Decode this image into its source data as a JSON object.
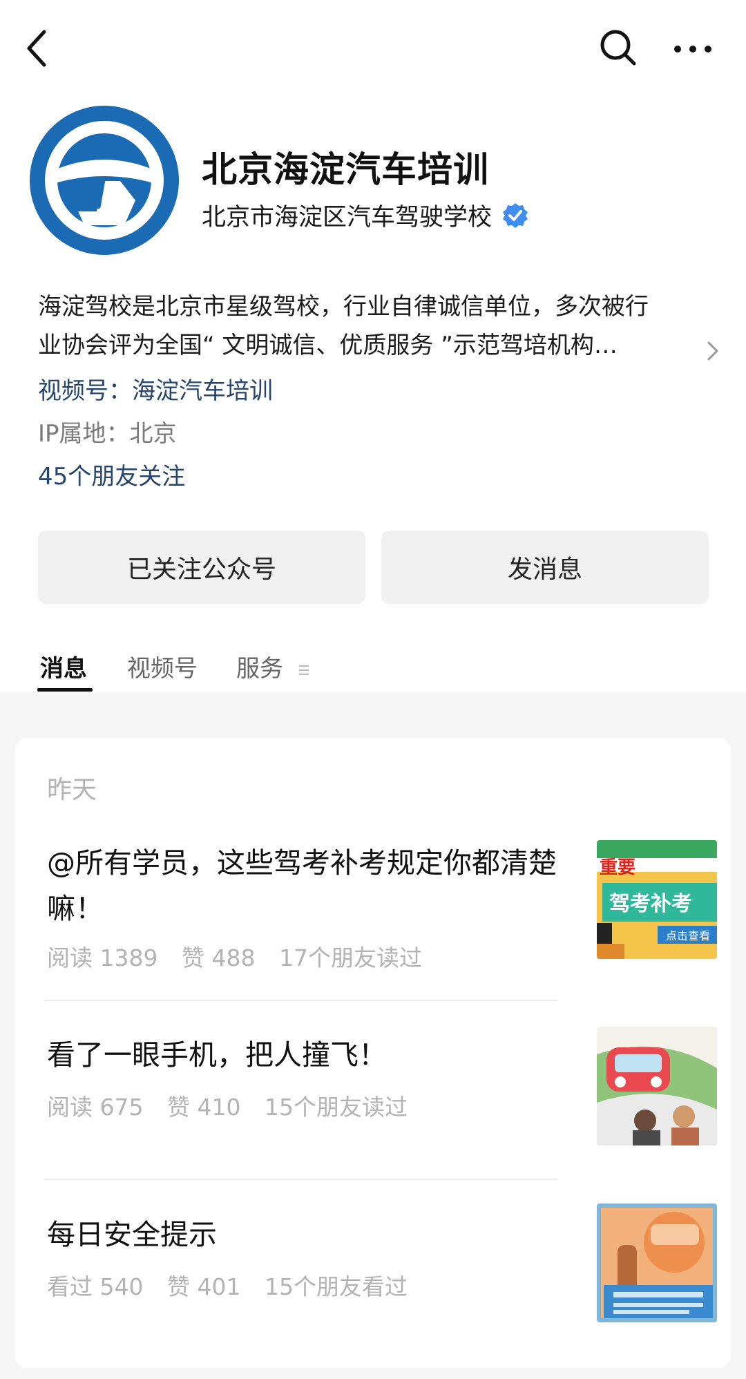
{
  "account": {
    "name": "北京海淀汽车培训",
    "organization": "北京市海淀区汽车驾驶学校",
    "description_line1": "海淀驾校是北京市星级驾校，行业自律诚信单位，多次被行",
    "description_line2": "业协会评为全国“ 文明诚信、优质服务 ”示范驾培机构…",
    "channel": "视频号：海淀汽车培训",
    "ip_location": "IP属地：北京",
    "friends_following": "45个朋友关注"
  },
  "buttons": {
    "follow_label": "已关注公众号",
    "message_label": "发消息"
  },
  "tabs": [
    {
      "label": "消息",
      "active": true
    },
    {
      "label": "视频号",
      "active": false
    },
    {
      "label": "服务",
      "active": false
    }
  ],
  "feed": {
    "date_label": "昨天",
    "articles": [
      {
        "title": "@所有学员，这些驾考补考规定你都清楚嘛！",
        "stat1": "阅读 1389",
        "stat2": "赞 488",
        "stat3": "17个朋友读过",
        "thumb_text1": "重要",
        "thumb_text2": "驾考补考",
        "thumb_text3": "点击查看"
      },
      {
        "title": "看了一眼手机，把人撞飞！",
        "stat1": "阅读 675",
        "stat2": "赞 410",
        "stat3": "15个朋友读过"
      },
      {
        "title": "每日安全提示",
        "stat1": "看过 540",
        "stat2": "赞 401",
        "stat3": "15个朋友看过"
      }
    ]
  },
  "icons": {
    "back": "chevron-left-icon",
    "search": "search-icon",
    "more": "more-icon",
    "verified": "verified-icon",
    "description_expand": "chevron-right-icon",
    "tab_service_menu": "menu-icon"
  },
  "colors": {
    "logo_blue": "#1a6bb3",
    "link_blue": "#26456e",
    "verified_blue": "#3d8ef0",
    "button_bg": "#f1f1f1",
    "feed_bg": "#f6f6f6",
    "muted_text": "#b3b3b3"
  }
}
